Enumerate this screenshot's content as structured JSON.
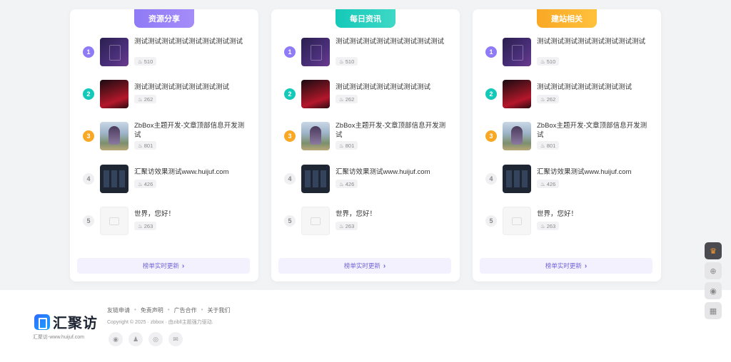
{
  "cards": [
    {
      "head": "资源分享",
      "items": [
        {
          "rank": "1",
          "title": "测试测试测试测试测试测试测试测试",
          "views": "510"
        },
        {
          "rank": "2",
          "title": "测试测试测试测试测试测试测试",
          "views": "262"
        },
        {
          "rank": "3",
          "title": "ZbBox主题开发-文章顶部信息开发测试",
          "views": "801"
        },
        {
          "rank": "4",
          "title": "汇聚访效果测试www.huijuf.com",
          "views": "426"
        },
        {
          "rank": "5",
          "title": "世界，您好！",
          "views": "263"
        }
      ],
      "more": "榜单实时更新"
    },
    {
      "head": "每日资讯",
      "items": [
        {
          "rank": "1",
          "title": "测试测试测试测试测试测试测试测试",
          "views": "510"
        },
        {
          "rank": "2",
          "title": "测试测试测试测试测试测试测试",
          "views": "262"
        },
        {
          "rank": "3",
          "title": "ZbBox主题开发-文章顶部信息开发测试",
          "views": "801"
        },
        {
          "rank": "4",
          "title": "汇聚访效果测试www.huijuf.com",
          "views": "426"
        },
        {
          "rank": "5",
          "title": "世界，您好！",
          "views": "263"
        }
      ],
      "more": "榜单实时更新"
    },
    {
      "head": "建站相关",
      "items": [
        {
          "rank": "1",
          "title": "测试测试测试测试测试测试测试测试",
          "views": "510"
        },
        {
          "rank": "2",
          "title": "测试测试测试测试测试测试测试",
          "views": "262"
        },
        {
          "rank": "3",
          "title": "ZbBox主题开发-文章顶部信息开发测试",
          "views": "801"
        },
        {
          "rank": "4",
          "title": "汇聚访效果测试www.huijuf.com",
          "views": "426"
        },
        {
          "rank": "5",
          "title": "世界，您好！",
          "views": "263"
        }
      ],
      "more": "榜单实时更新"
    }
  ],
  "footer": {
    "logo_text": "汇聚访",
    "logo_sub": "汇聚访-www.huijuf.com",
    "links": [
      "友链申请",
      "免责声明",
      "广告合作",
      "关于我们"
    ],
    "copyright": "Copyright © 2025 · zbbox · 由zibll主题强力驱动.",
    "socials": [
      "wechat-icon",
      "qq-icon",
      "weibo-icon",
      "mail-icon"
    ]
  },
  "side": [
    "crown-icon",
    "add-icon",
    "wechat-icon",
    "qrcode-icon"
  ],
  "colors": {
    "rank1": "#8f7bf7",
    "rank2": "#14c9b9",
    "rank3": "#f9a825",
    "more_text": "#7062d9"
  }
}
